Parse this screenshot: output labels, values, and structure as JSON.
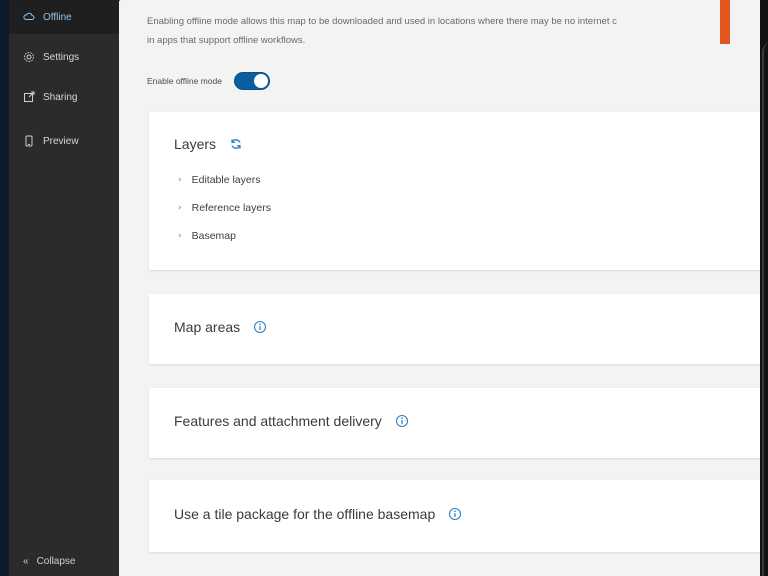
{
  "sidebar": {
    "items": [
      {
        "label": "Offline",
        "icon": "offline-icon",
        "active": true
      },
      {
        "label": "Settings",
        "icon": "gear-icon",
        "active": false
      },
      {
        "label": "Sharing",
        "icon": "share-icon",
        "active": false
      },
      {
        "label": "Preview",
        "icon": "phone-icon",
        "active": false
      }
    ],
    "collapse_label": "Collapse",
    "collapse_icon": "double-chevron-left-icon"
  },
  "main": {
    "intro_line1": "Enabling offline mode allows this map to be downloaded and used in locations where there may be no internet c",
    "intro_line2": "in apps that support offline workflows.",
    "toggle_label": "Enable offline mode",
    "toggle_on": true
  },
  "cards": {
    "layers": {
      "title": "Layers",
      "icon": "refresh-icon",
      "items": [
        "Editable layers",
        "Reference layers",
        "Basemap"
      ]
    },
    "map_areas": {
      "title": "Map areas",
      "icon": "info-icon"
    },
    "features_delivery": {
      "title": "Features and attachment delivery",
      "icon": "info-icon"
    },
    "tile_package": {
      "title": "Use a tile package for the offline basemap",
      "icon": "info-icon"
    }
  },
  "colors": {
    "accent": "#0c5f9e",
    "sidebar_bg": "#2b2b2b",
    "active_text": "#8fc3ea",
    "info_icon": "#2b7fc4",
    "marker": "#e2561f"
  }
}
